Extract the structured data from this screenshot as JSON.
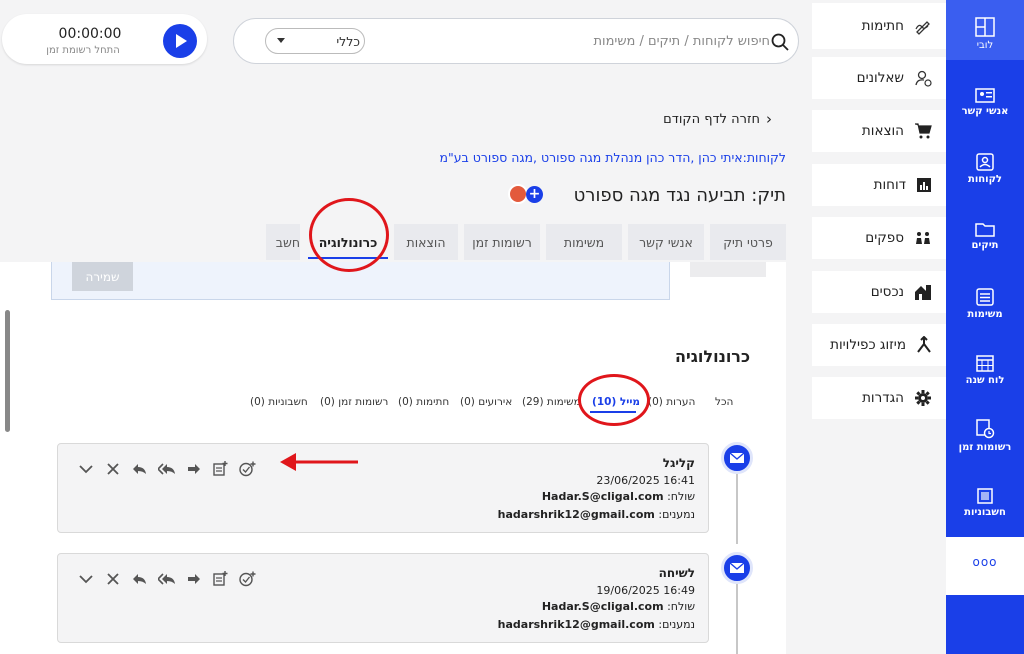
{
  "topbar": {
    "timer_time": "00:00:00",
    "timer_label": "התחל רשומת זמן",
    "search_placeholder": "חיפוש לקוחות / תיקים / משימות",
    "search_scope": "כללי"
  },
  "bluenav": {
    "items": [
      {
        "label": "לובי",
        "icon": "lobby-icon"
      },
      {
        "label": "אנשי קשר",
        "icon": "contacts-card-icon"
      },
      {
        "label": "לקוחות",
        "icon": "clients-icon"
      },
      {
        "label": "תיקים",
        "icon": "folder-icon"
      },
      {
        "label": "משימות",
        "icon": "tasks-icon"
      },
      {
        "label": "לוח שנה",
        "icon": "calendar-icon"
      },
      {
        "label": "רשומות זמן",
        "icon": "time-entries-icon"
      },
      {
        "label": "חשבוניות",
        "icon": "invoices-icon"
      }
    ],
    "more": "ooo"
  },
  "sidemenu": {
    "items": [
      {
        "label": "חתימות",
        "icon": "signature-icon"
      },
      {
        "label": "שאלונים",
        "icon": "questionnaire-icon"
      },
      {
        "label": "הוצאות",
        "icon": "cart-icon"
      },
      {
        "label": "דוחות",
        "icon": "reports-icon"
      },
      {
        "label": "ספקים",
        "icon": "suppliers-icon"
      },
      {
        "label": "נכסים",
        "icon": "assets-icon"
      },
      {
        "label": "מיזוג כפילויות",
        "icon": "merge-icon"
      },
      {
        "label": "הגדרות",
        "icon": "gear-icon"
      }
    ]
  },
  "header": {
    "back": "חזרה לדף הקודם",
    "crumbs": "לקוחות:איתי כהן ,הדר כהן מנהלת מגה ספורט ,מגה ספורט בע\"מ",
    "case_title": "תיק: תביעה נגד מגה ספורט"
  },
  "tabs": [
    "פרטי תיק",
    "אנשי קשר",
    "משימות",
    "רשומות זמן",
    "הוצאות",
    "כרונולוגיה",
    "חשב"
  ],
  "save_label": "שמירה",
  "chronology": {
    "title": "כרונולוגיה",
    "filters": [
      "הכל",
      "הערות (0)",
      "מייל (10)",
      "משימות (29)",
      "אירועים (0)",
      "חתימות (0)",
      "רשומות זמן (0)",
      "חשבוניות (0)"
    ],
    "emails": [
      {
        "title": "קליגל",
        "datetime": "16:41 23/06/2025",
        "from_label": "שולח:",
        "from": "Hadar.S@cligal.com",
        "to_label": "נמענים:",
        "to": "hadarshrik12@gmail.com"
      },
      {
        "title": "לשיחה",
        "datetime": "16:49 19/06/2025",
        "from_label": "שולח:",
        "from": "Hadar.S@cligal.com",
        "to_label": "נמענים:",
        "to": "hadarshrik12@gmail.com"
      }
    ]
  },
  "colors": {
    "brand_blue": "#1a3fe8",
    "annotation_red": "#e0161b"
  }
}
